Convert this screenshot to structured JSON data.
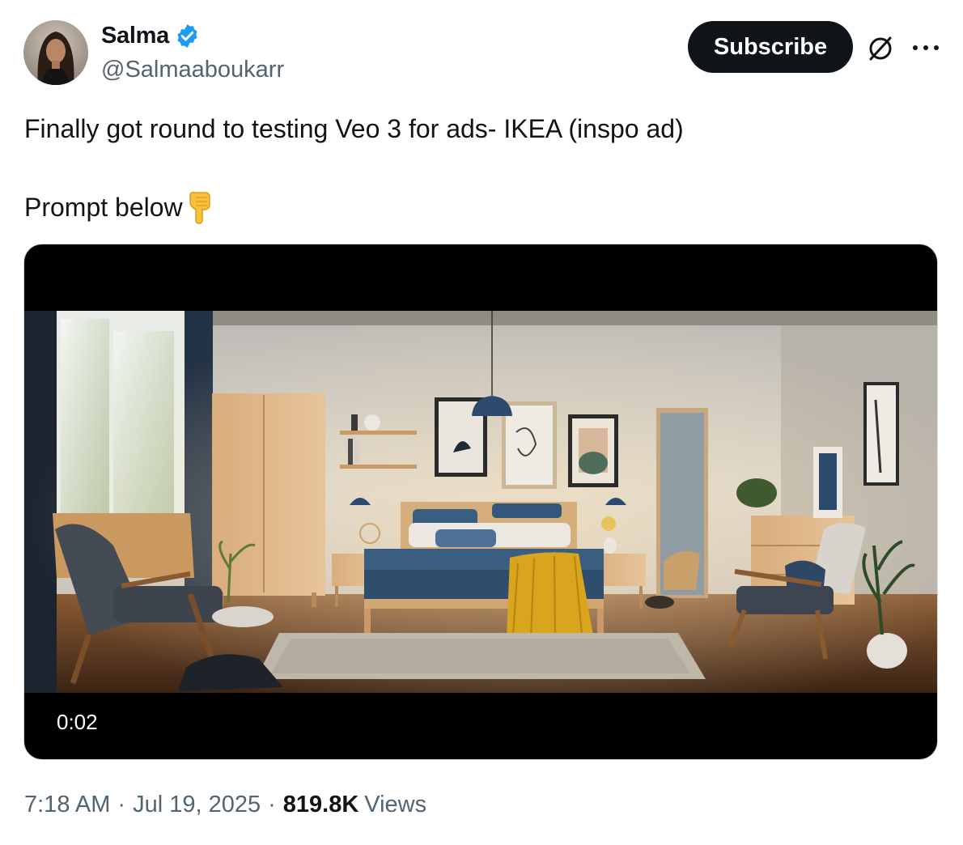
{
  "author": {
    "display_name": "Salma",
    "handle": "@Salmaaboukarr",
    "verified_icon": "verified-badge-icon",
    "verified_color": "#1d9bf0"
  },
  "actions": {
    "subscribe_label": "Subscribe",
    "grok_icon": "grok-icon",
    "more_icon": "more-options-icon"
  },
  "tweet": {
    "line1": "Finally got round to testing Veo 3 for ads- IKEA (inspo ad)",
    "line2": "Prompt below",
    "emoji": "backhand-index-pointing-down-icon"
  },
  "media": {
    "type": "video",
    "elapsed": "0:02"
  },
  "meta": {
    "time": "7:18 AM",
    "date": "Jul 19, 2025",
    "separator": "·",
    "views_count": "819.8K",
    "views_label": "Views"
  },
  "colors": {
    "text_primary": "#0f1419",
    "text_secondary": "#536471",
    "button_bg": "#0f1419"
  }
}
